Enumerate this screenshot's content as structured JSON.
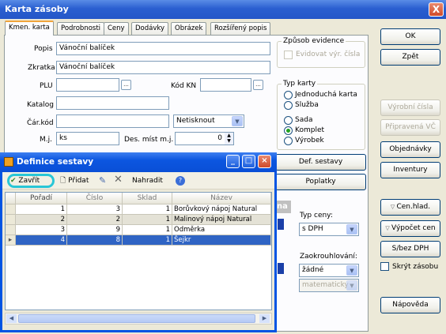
{
  "window": {
    "title": "Karta zásoby",
    "close": "X"
  },
  "tabs": [
    "Kmen. karta",
    "Podrobnosti",
    "Ceny",
    "Dodávky",
    "Obrázek",
    "Rozšířený popis"
  ],
  "form": {
    "popis_label": "Popis",
    "popis_value": "Vánoční balíček",
    "zkratka_label": "Zkratka",
    "zkratka_value": "Vánoční balíček",
    "plu_label": "PLU",
    "plu_value": "",
    "kodkn_label": "Kód KN",
    "kodkn_value": "",
    "katalog_label": "Katalog",
    "katalog_value": "",
    "carkod_label": "Čár.kód",
    "carkod_value": "",
    "carkod_select": "Netisknout",
    "mj_label": "M.j.",
    "mj_value": "ks",
    "desmist_label": "Des. míst m.j.",
    "desmist_value": "0",
    "ellipsis": "..."
  },
  "zpusob_evidence": {
    "title": "Způsob evidence",
    "checkbox_label": "Evidovat výr. čísla"
  },
  "typ_karty": {
    "title": "Typ karty",
    "options": [
      "Jednoduchá karta",
      "Služba",
      "Sada",
      "Komplet",
      "Výrobek"
    ],
    "selected": "Komplet"
  },
  "mid_buttons": {
    "def_sestavy": "Def. sestavy",
    "poplatky": "Poplatky"
  },
  "ceny": {
    "partial_label": "na",
    "typ_ceny_label": "Typ ceny:",
    "typ_ceny_value": "s DPH",
    "zaokrouhlovani_label": "Zaokrouhlování:",
    "zaokrouhlovani_value": "žádné",
    "zaokrouhlovani_mode": "matematicky"
  },
  "right_buttons": {
    "ok": "OK",
    "zpet": "Zpět",
    "vyrobni_cisla": "Výrobní čísla",
    "pripravena_vc": "Připravená VČ",
    "objednavky": "Objednávky",
    "inventury": "Inventury",
    "cen_hlad": "Cen.hlad.",
    "vypocet_cen": "Výpočet cen",
    "s_bez_dph": "S/bez DPH",
    "skryt_zasobu": "Skrýt zásobu",
    "napoveda": "Nápověda"
  },
  "definice": {
    "title": "Definice sestavy",
    "toolbar": {
      "zavrit": "Zavřít",
      "pridat": "Přidat",
      "nahradit": "Nahradit"
    },
    "highlight_color": "#29c6d6",
    "columns": [
      "Pořadí",
      "Číslo",
      "Sklad",
      "Název"
    ],
    "rows": [
      {
        "poradi": "1",
        "cislo": "3",
        "sklad": "1",
        "nazev": "Borůvkový nápoj Natural"
      },
      {
        "poradi": "2",
        "cislo": "2",
        "sklad": "1",
        "nazev": "Malinový nápoj Natural"
      },
      {
        "poradi": "3",
        "cislo": "9",
        "sklad": "1",
        "nazev": "Odměrka"
      },
      {
        "poradi": "4",
        "cislo": "8",
        "sklad": "1",
        "nazev": "Šejkr"
      }
    ],
    "selected_row": 3
  }
}
